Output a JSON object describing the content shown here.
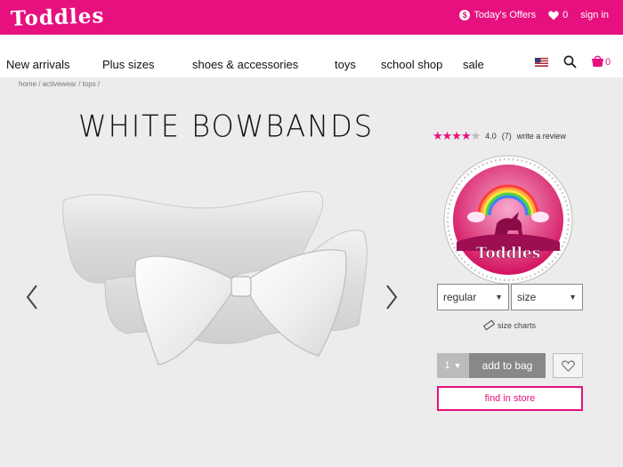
{
  "brand": {
    "logo_text": "Toddles",
    "accent": "#e6117f"
  },
  "topbar": {
    "offers_label": "Today's Offers",
    "offers_icon": "dollar-coin-icon",
    "wishlist_count": "0",
    "signin_label": "sign in"
  },
  "nav": {
    "items": [
      {
        "label": "New arrivals"
      },
      {
        "label": "Plus sizes"
      },
      {
        "label": "shoes & accessories"
      },
      {
        "label": "toys"
      },
      {
        "label": "school shop"
      },
      {
        "label": "sale"
      }
    ],
    "cart_count": "0"
  },
  "breadcrumb": "home / activewear / tops /",
  "product": {
    "title": "WHITE BOWBANDS",
    "rating_value": "4.0",
    "rating_stars": 4,
    "review_count": "(7)",
    "write_review_label": "write a review",
    "badge_text": "Toddles"
  },
  "purchase": {
    "fit_value": "regular",
    "size_placeholder": "size",
    "size_charts_label": "size charts",
    "quantity": "1",
    "add_to_bag_label": "add to bag",
    "find_in_store_label": "find in store"
  }
}
